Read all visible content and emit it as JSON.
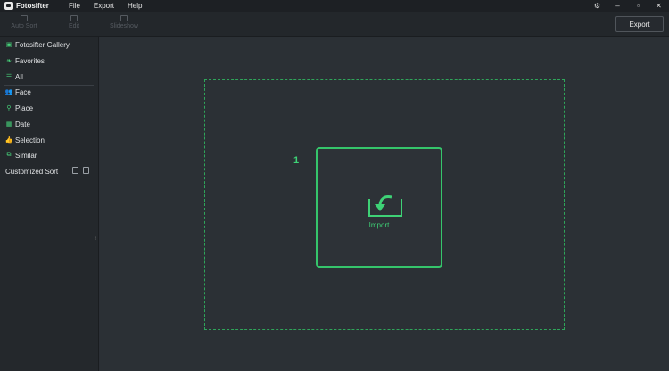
{
  "app": {
    "name": "Fotosifter"
  },
  "menu": [
    "File",
    "Export",
    "Help"
  ],
  "toolbar": {
    "tools": [
      "Auto Sort",
      "Edit",
      "Slideshow"
    ],
    "export_label": "Export"
  },
  "sidebar": {
    "items": [
      {
        "label": "Fotosifter Gallery",
        "icon": "gallery-icon"
      },
      {
        "label": "Favorites",
        "icon": "favorites-icon"
      },
      {
        "label": "All",
        "icon": "list-icon"
      },
      {
        "label": "Face",
        "icon": "face-icon"
      },
      {
        "label": "Place",
        "icon": "place-icon"
      },
      {
        "label": "Date",
        "icon": "calendar-icon"
      },
      {
        "label": "Selection",
        "icon": "thumbs-up-icon"
      },
      {
        "label": "Similar",
        "icon": "similar-icon"
      }
    ],
    "customized_sort": "Customized Sort"
  },
  "main": {
    "step_number": "1",
    "import_label": "Import"
  },
  "colors": {
    "accent": "#35c56b",
    "background": "#2b3035",
    "sidebar": "#24282c"
  }
}
